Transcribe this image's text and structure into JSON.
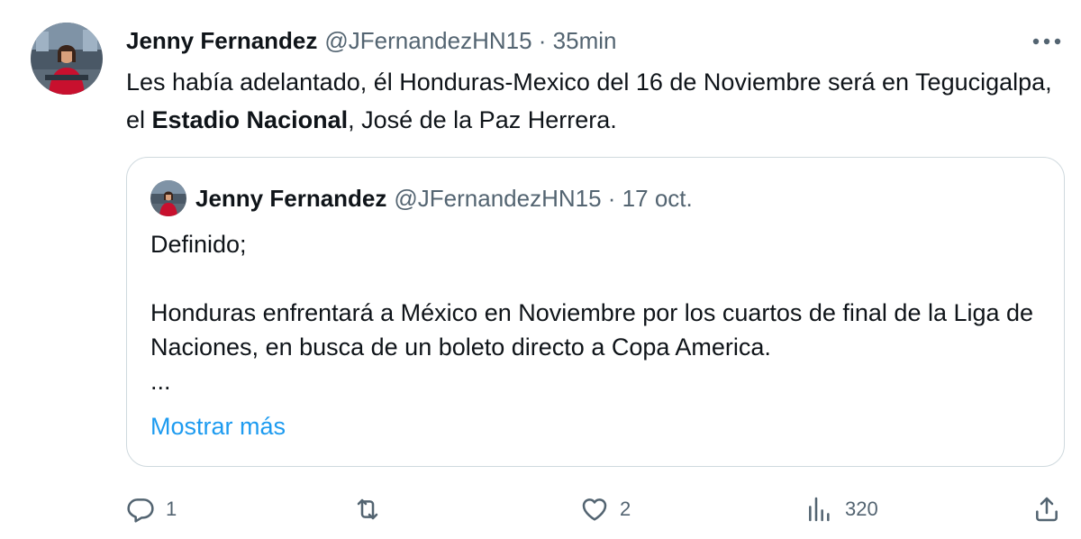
{
  "tweet": {
    "author_name": "Jenny Fernandez",
    "author_meta": "@JFernandezHN15 · 35min",
    "text_part1": "Les había adelantado, él Honduras-Mexico del 16 de Noviembre será en Tegucigalpa, el ",
    "text_bold": "Estadio Nacional",
    "text_part2": ", José de la Paz Herrera."
  },
  "quoted": {
    "author_name": "Jenny Fernandez",
    "author_meta": "@JFernandezHN15 · 17 oct.",
    "lines": [
      "Definido;",
      "",
      "Honduras enfrentará a México en Noviembre por los cuartos de final de la Liga de Naciones, en busca de un boleto directo a Copa America.",
      "..."
    ],
    "show_more": "Mostrar más"
  },
  "actions": {
    "replies": "1",
    "retweets": "",
    "likes": "2",
    "views": "320"
  },
  "icons": {
    "more": "more-horizontal-icon",
    "reply": "reply-icon",
    "retweet": "retweet-icon",
    "like": "heart-icon",
    "views": "views-chart-icon",
    "share": "share-icon"
  },
  "colors": {
    "text": "#0f1419",
    "secondary": "#536471",
    "link": "#1d9bf0",
    "border": "#cfd9de"
  }
}
